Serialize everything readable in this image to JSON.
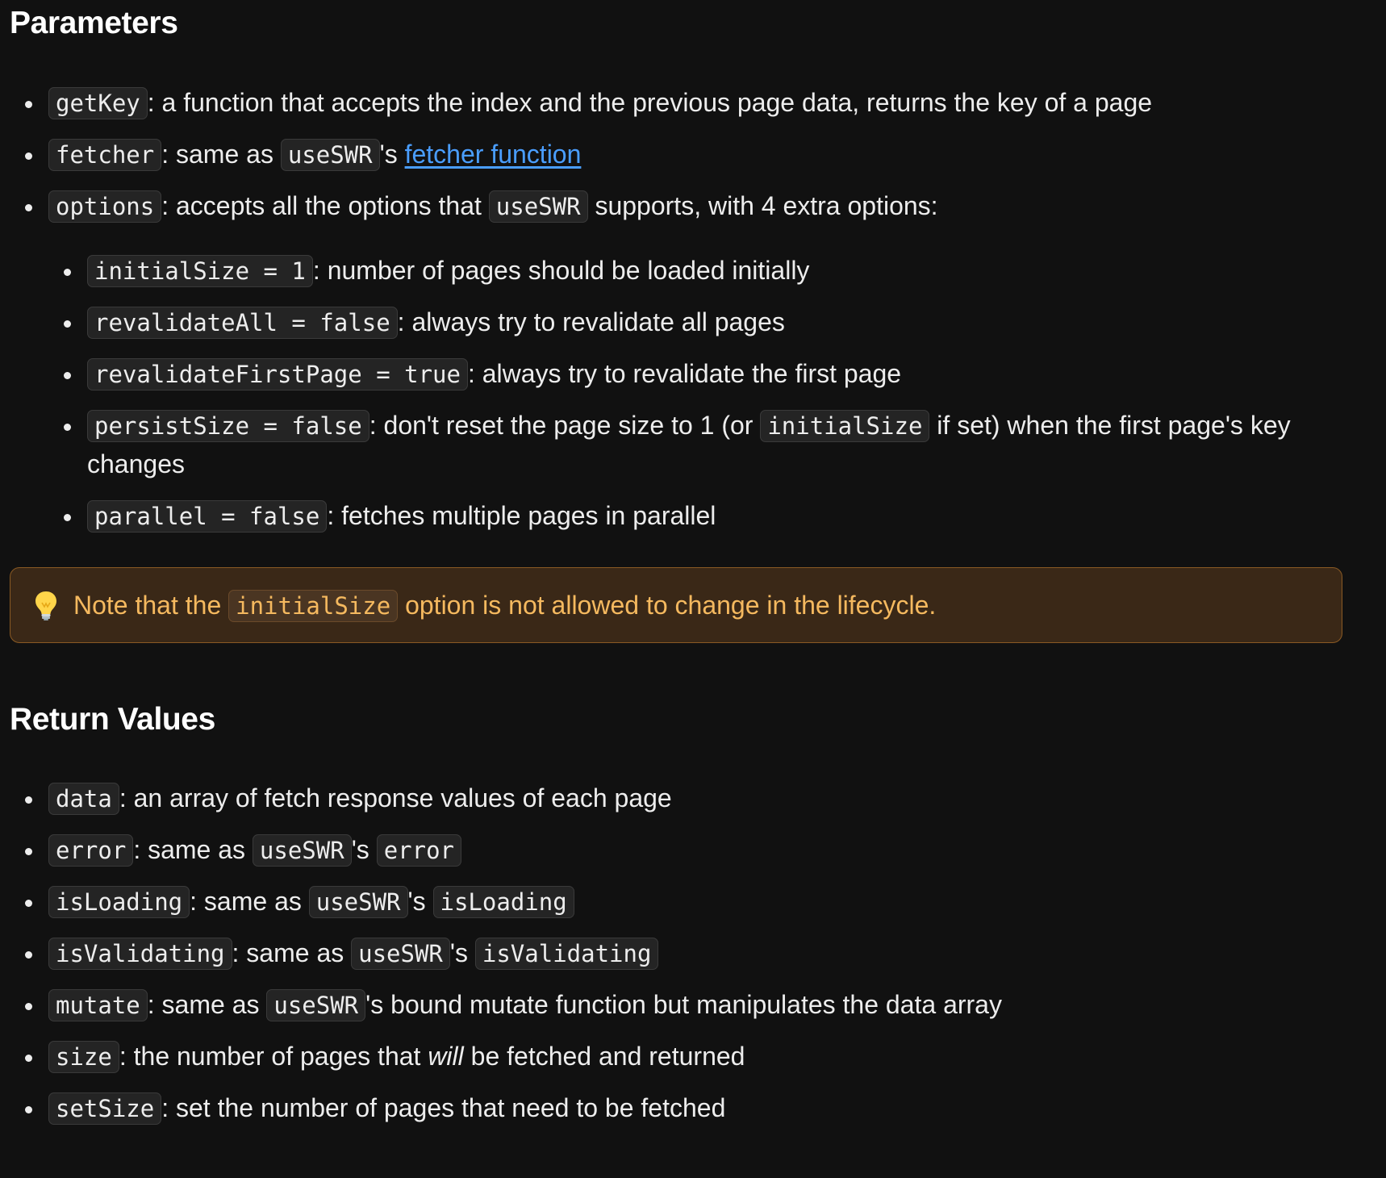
{
  "parameters": {
    "title": "Parameters",
    "items": [
      {
        "code": "getKey",
        "text": ": a function that accepts the index and the previous page data, returns the key of a page"
      },
      {
        "code": "fetcher",
        "text1": ": same as ",
        "code2": "useSWR",
        "text2": "'s ",
        "link": "fetcher function"
      },
      {
        "code": "options",
        "text1": ": accepts all the options that ",
        "code2": "useSWR",
        "text2": " supports, with 4 extra options:"
      }
    ],
    "options": [
      {
        "code": "initialSize = 1",
        "text": ": number of pages should be loaded initially"
      },
      {
        "code": "revalidateAll = false",
        "text": ": always try to revalidate all pages"
      },
      {
        "code": "revalidateFirstPage = true",
        "text": ": always try to revalidate the first page"
      },
      {
        "code": "persistSize = false",
        "text1": ": don't reset the page size to 1 (or ",
        "code2": "initialSize",
        "text2": " if set) when the first page's key changes"
      },
      {
        "code": "parallel = false",
        "text": ": fetches multiple pages in parallel"
      }
    ]
  },
  "callout": {
    "icon": "lightbulb-icon",
    "text1": "Note that the ",
    "code": "initialSize",
    "text2": " option is not allowed to change in the lifecycle."
  },
  "returns": {
    "title": "Return Values",
    "items": [
      {
        "code": "data",
        "text": ": an array of fetch response values of each page"
      },
      {
        "code": "error",
        "text1": ": same as ",
        "code2": "useSWR",
        "text2": "'s ",
        "code3": "error"
      },
      {
        "code": "isLoading",
        "text1": ": same as ",
        "code2": "useSWR",
        "text2": "'s ",
        "code3": "isLoading"
      },
      {
        "code": "isValidating",
        "text1": ": same as ",
        "code2": "useSWR",
        "text2": "'s ",
        "code3": "isValidating"
      },
      {
        "code": "mutate",
        "text1": ": same as ",
        "code2": "useSWR",
        "text2": "'s bound mutate function but manipulates the data array"
      },
      {
        "code": "size",
        "text1": ": the number of pages that ",
        "em": "will",
        "text2": " be fetched and returned"
      },
      {
        "code": "setSize",
        "text": ": set the number of pages that need to be fetched"
      }
    ]
  },
  "colors": {
    "background": "#111111",
    "text": "#ededed",
    "link": "#4a9eff",
    "callout_bg": "#3a2817",
    "callout_text": "#f5b95f"
  }
}
